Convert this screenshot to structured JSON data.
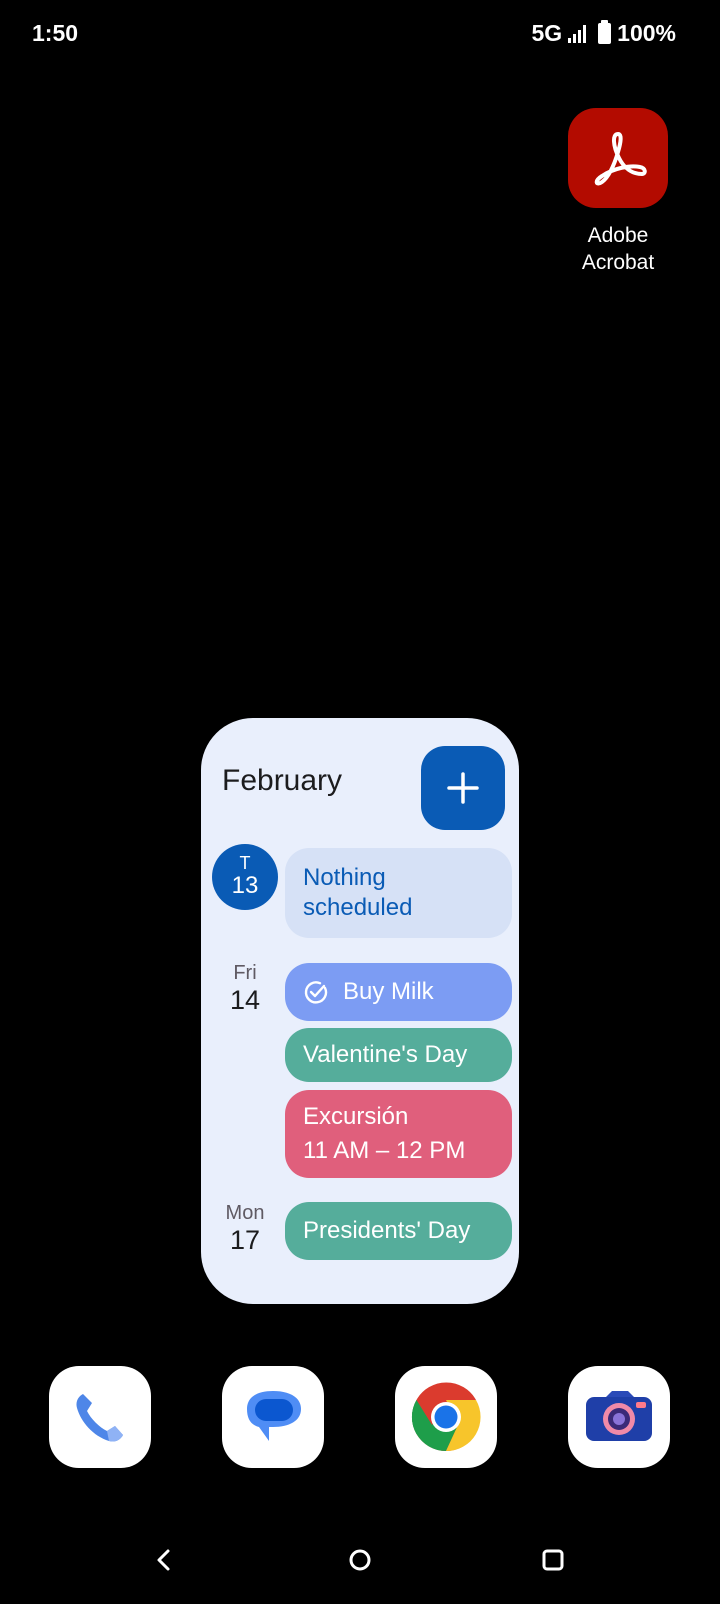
{
  "status_bar": {
    "time": "1:50",
    "network": "5G",
    "battery": "100%"
  },
  "home_apps": [
    {
      "label_line1": "Adobe",
      "label_line2": "Acrobat",
      "icon": "adobe-acrobat-icon",
      "color": "#b30b00"
    }
  ],
  "calendar_widget": {
    "month": "February",
    "add_icon": "plus-icon",
    "today": {
      "dow": "T",
      "day": "13",
      "event": "Nothing scheduled"
    },
    "days": [
      {
        "dow": "Fri",
        "day": "14",
        "events": [
          {
            "title": "Buy Milk",
            "type": "task",
            "icon": "check-circle-icon"
          },
          {
            "title": "Valentine's Day",
            "type": "holiday"
          },
          {
            "title": "Excursión",
            "time": "11 AM – 12 PM",
            "type": "event"
          }
        ]
      },
      {
        "dow": "Mon",
        "day": "17",
        "events": [
          {
            "title": "Presidents' Day",
            "type": "holiday"
          }
        ]
      }
    ],
    "colors": {
      "background": "#e9effc",
      "accent": "#0a5bb5",
      "task": "#7c9cf3",
      "holiday": "#55ad9b",
      "event": "#e05f7c"
    }
  },
  "dock": [
    {
      "app": "Phone",
      "icon": "phone-icon"
    },
    {
      "app": "Messages",
      "icon": "messages-icon"
    },
    {
      "app": "Chrome",
      "icon": "chrome-icon"
    },
    {
      "app": "Camera",
      "icon": "camera-icon"
    }
  ],
  "nav_bar": [
    "back-icon",
    "home-icon",
    "recents-icon"
  ]
}
